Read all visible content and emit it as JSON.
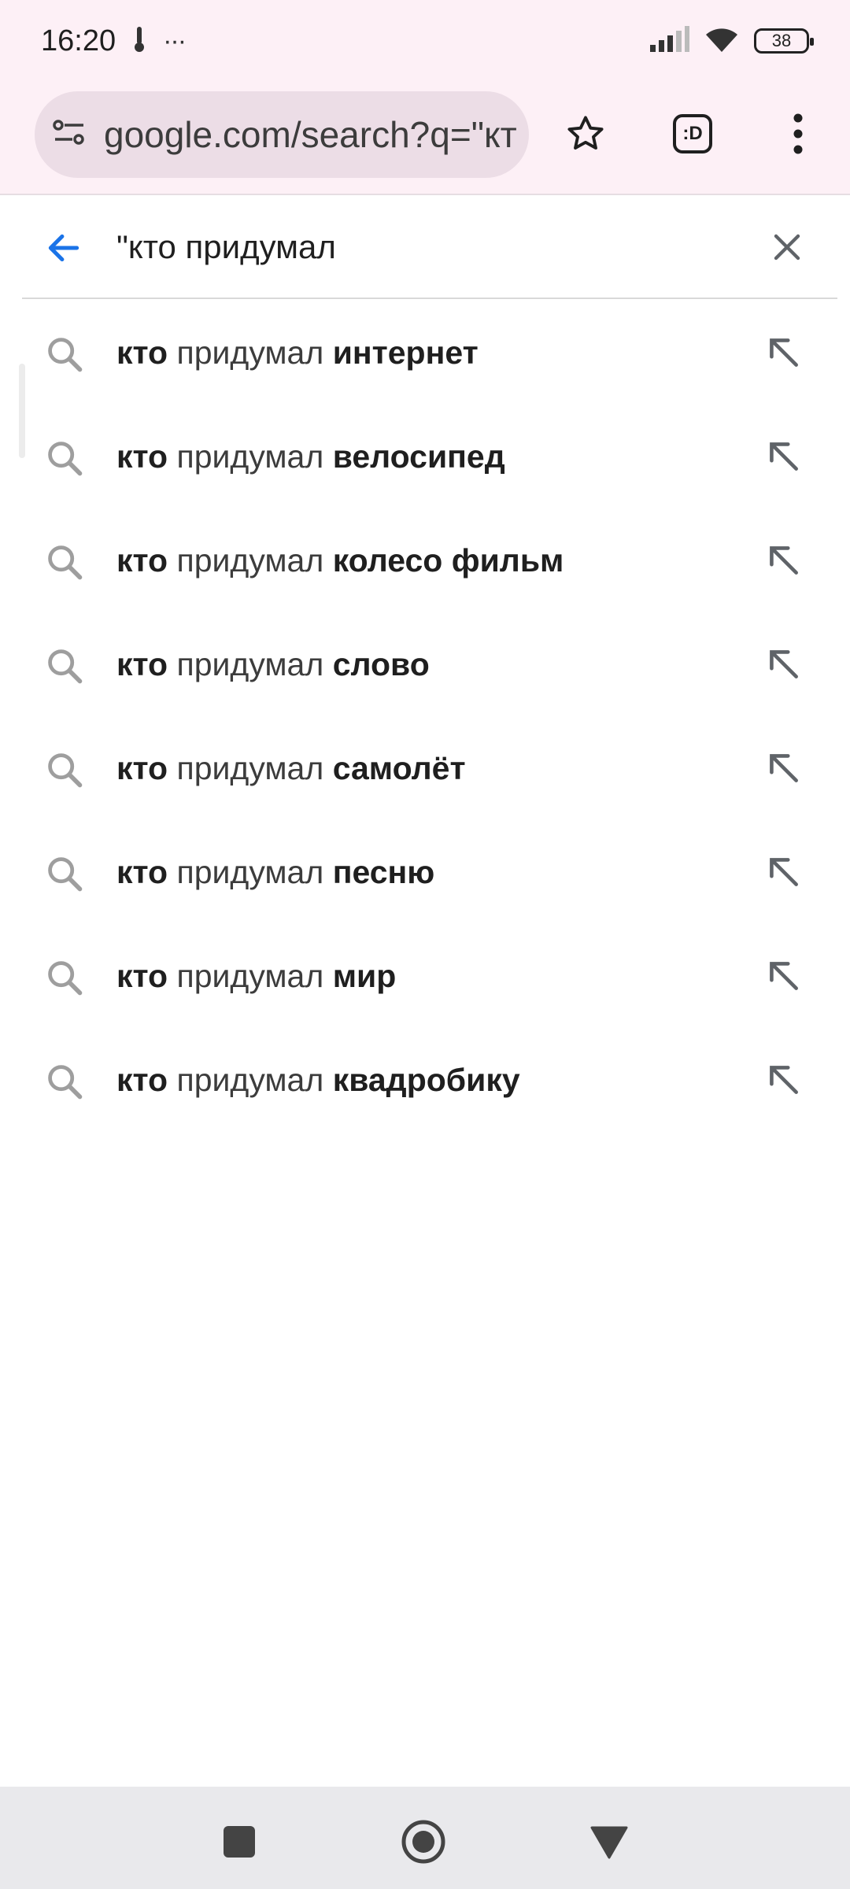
{
  "status_bar": {
    "time": "16:20",
    "more": "···",
    "battery": "38",
    "icons": [
      "thermometer-icon",
      "signal-icon",
      "wifi-icon",
      "battery-icon"
    ]
  },
  "toolbar": {
    "url": "google.com/search?q=\"кт",
    "icons": [
      "site-settings-icon",
      "star-icon",
      "tab-switcher-icon",
      "menu-icon"
    ],
    "tab_label": ":D"
  },
  "search": {
    "value": "\"кто придумал"
  },
  "suggestions": [
    {
      "pre": "кто",
      "mid": " придумал ",
      "post": "интернет"
    },
    {
      "pre": "кто",
      "mid": " придумал ",
      "post": "велосипед"
    },
    {
      "pre": "кто",
      "mid": " придумал ",
      "post": "колесо фильм"
    },
    {
      "pre": "кто",
      "mid": " придумал ",
      "post": "слово"
    },
    {
      "pre": "кто",
      "mid": " придумал ",
      "post": "самолёт"
    },
    {
      "pre": "кто",
      "mid": " придумал ",
      "post": "песню"
    },
    {
      "pre": "кто",
      "mid": " придумал ",
      "post": "мир"
    },
    {
      "pre": "кто",
      "mid": " придумал ",
      "post": "квадробику"
    }
  ],
  "colors": {
    "accent": "#1a73e8",
    "toolbar_bg": "#fdf0f6",
    "url_pill_bg": "#ecdde6",
    "nav_bg": "#e9e9ec"
  }
}
